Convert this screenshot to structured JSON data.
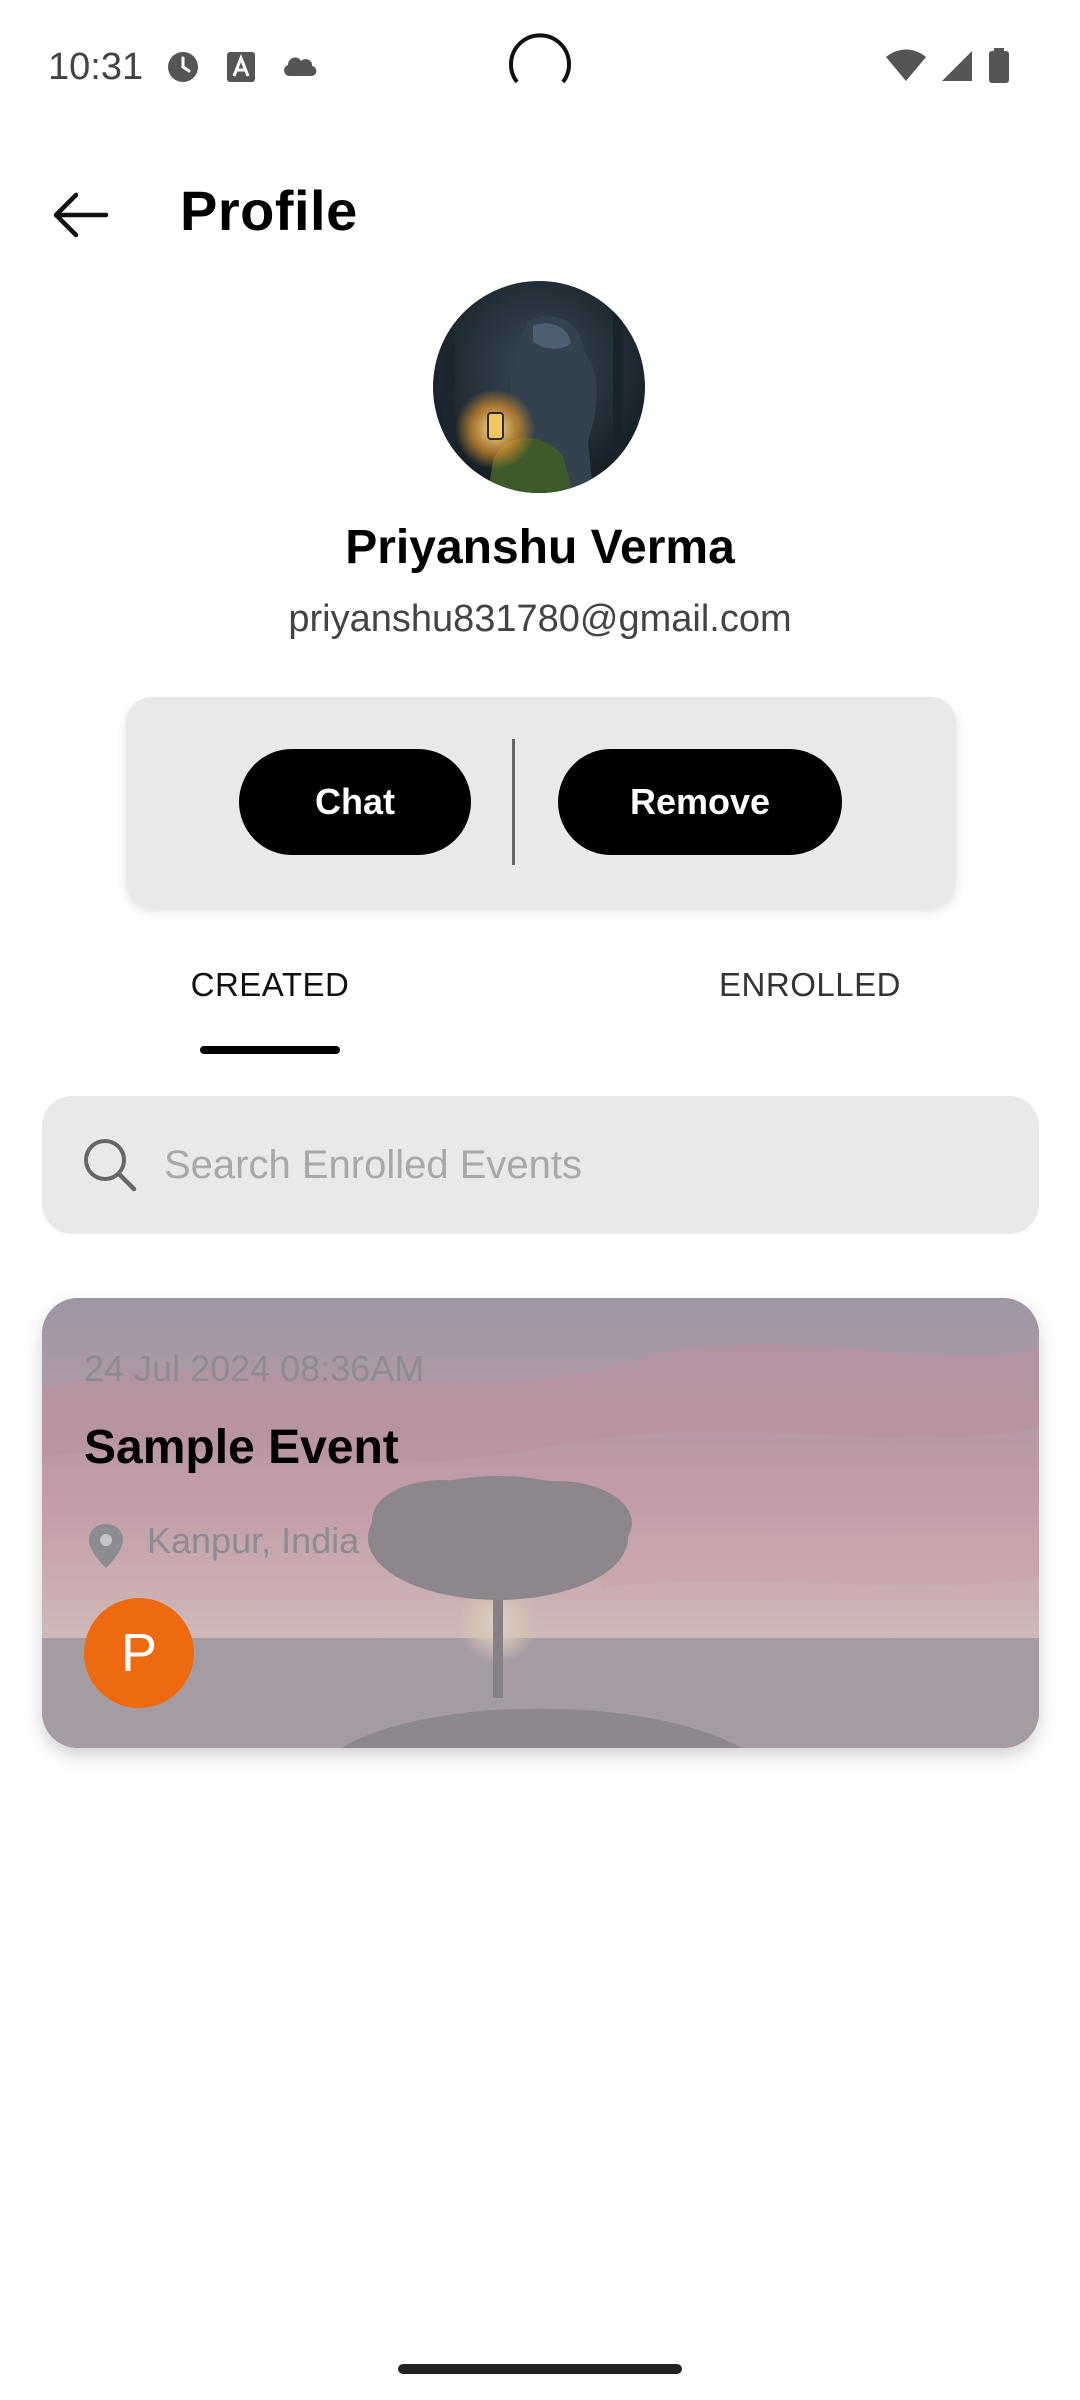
{
  "status_bar": {
    "time": "10:31",
    "left_icons": [
      "clock-icon",
      "a-box-icon",
      "cloud-icon"
    ],
    "right_icons": [
      "wifi-icon",
      "signal-icon",
      "battery-icon"
    ]
  },
  "header": {
    "title": "Profile",
    "back_icon": "arrow-left-icon"
  },
  "profile": {
    "name": "Priyanshu Verma",
    "email": "priyanshu831780@gmail.com"
  },
  "actions": {
    "chat_label": "Chat",
    "remove_label": "Remove"
  },
  "tabs": [
    {
      "label": "CREATED",
      "selected": true
    },
    {
      "label": "ENROLLED",
      "selected": false
    }
  ],
  "search": {
    "placeholder": "Search Enrolled Events",
    "value": ""
  },
  "events": [
    {
      "date": "24 Jul 2024 08:36AM",
      "title": "Sample Event",
      "location": "Kanpur, India",
      "avatar_letter": "P",
      "avatar_color": "#ee6a10"
    }
  ]
}
